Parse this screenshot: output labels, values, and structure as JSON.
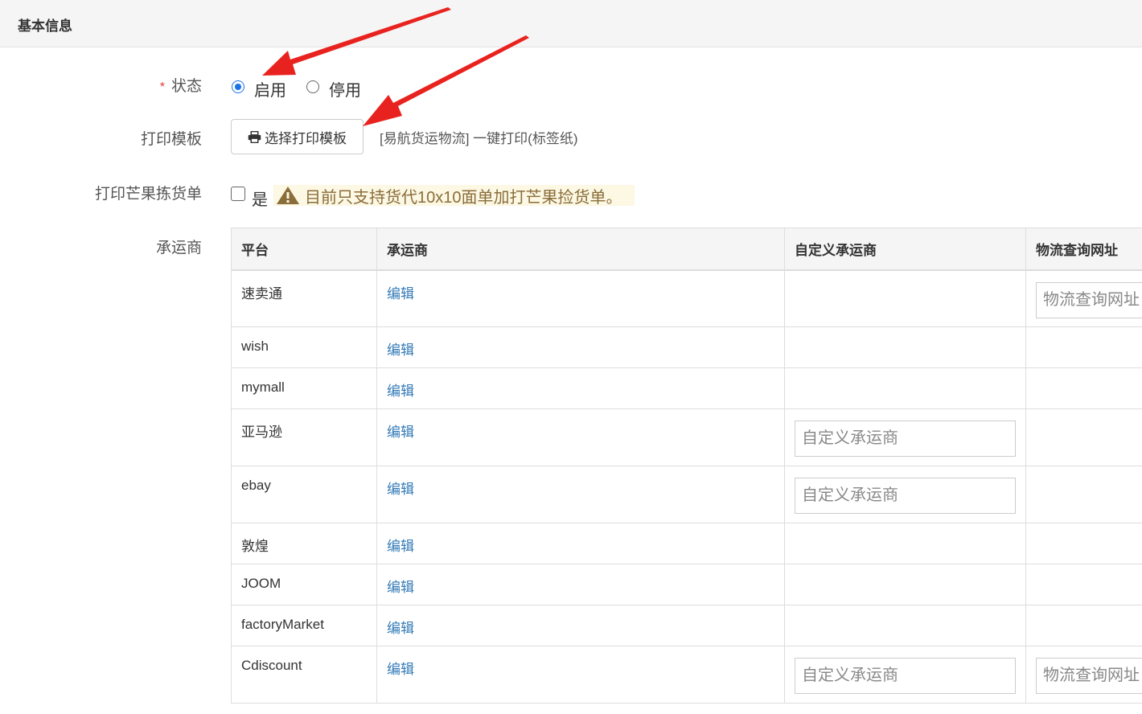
{
  "section": {
    "title": "基本信息"
  },
  "status": {
    "label": "状态",
    "required_mark": "*",
    "options": [
      {
        "label": "启用",
        "checked": true
      },
      {
        "label": "停用",
        "checked": false
      }
    ]
  },
  "print_template": {
    "label": "打印模板",
    "button_label": "选择打印模板",
    "button_icon": "print-icon",
    "selected_template": "[易航货运物流] 一键打印(标签纸)"
  },
  "mango_picklist": {
    "label": "打印芒果拣货单",
    "checkbox_label": "是",
    "checked": false,
    "warning_icon": "warning-icon",
    "warning_text": "目前只支持货代10x10面单加打芒果捡货单。"
  },
  "carrier": {
    "label": "承运商",
    "columns": [
      "平台",
      "承运商",
      "自定义承运商",
      "物流查询网址"
    ],
    "edit_label": "编辑",
    "custom_placeholder": "自定义承运商",
    "url_placeholder": "物流查询网址",
    "rows": [
      {
        "platform": "速卖通",
        "custom": false,
        "url": true
      },
      {
        "platform": "wish",
        "custom": false,
        "url": false
      },
      {
        "platform": "mymall",
        "custom": false,
        "url": false
      },
      {
        "platform": "亚马逊",
        "custom": true,
        "url": false
      },
      {
        "platform": "ebay",
        "custom": true,
        "url": false
      },
      {
        "platform": "敦煌",
        "custom": false,
        "url": false
      },
      {
        "platform": "JOOM",
        "custom": false,
        "url": false
      },
      {
        "platform": "factoryMarket",
        "custom": false,
        "url": false
      },
      {
        "platform": "Cdiscount",
        "custom": true,
        "url": true
      }
    ]
  },
  "colors": {
    "accent": "#1a73e8",
    "link": "#337ab7",
    "required": "#e2403a",
    "warning": "#8a6d3b",
    "warning_bg": "#fcf8e3",
    "annotation_arrow": "#e8231f"
  }
}
